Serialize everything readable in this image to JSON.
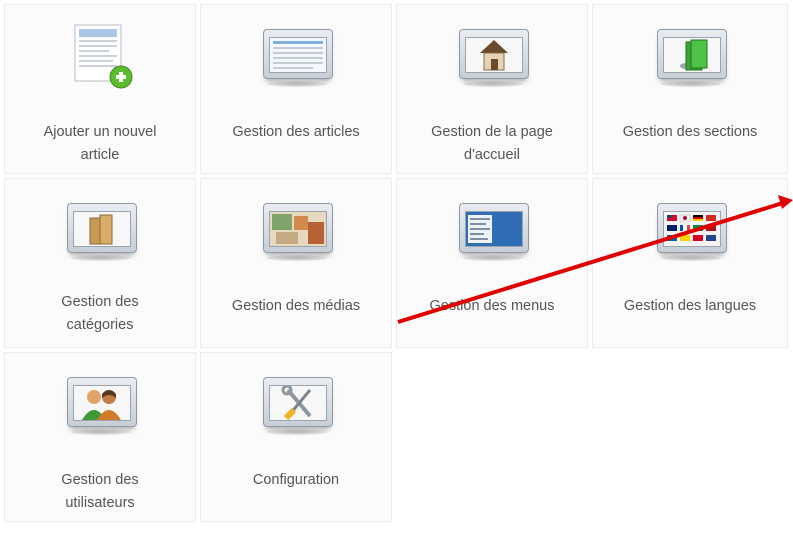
{
  "tiles": [
    {
      "label_lines": [
        "Ajouter un nouvel",
        "article"
      ],
      "icon": "add-article-icon"
    },
    {
      "label_lines": [
        "Gestion des articles"
      ],
      "icon": "articles-icon"
    },
    {
      "label_lines": [
        "Gestion de la page",
        "d'accueil"
      ],
      "icon": "home-page-icon"
    },
    {
      "label_lines": [
        "Gestion des sections"
      ],
      "icon": "sections-icon"
    },
    {
      "label_lines": [
        "Gestion des",
        "catégories"
      ],
      "icon": "categories-icon"
    },
    {
      "label_lines": [
        "Gestion des médias"
      ],
      "icon": "media-icon"
    },
    {
      "label_lines": [
        "Gestion des menus"
      ],
      "icon": "menus-icon"
    },
    {
      "label_lines": [
        "Gestion des langues"
      ],
      "icon": "languages-icon"
    },
    {
      "label_lines": [
        "Gestion des",
        "utilisateurs"
      ],
      "icon": "users-icon"
    },
    {
      "label_lines": [
        "Configuration"
      ],
      "icon": "configuration-icon"
    }
  ],
  "colors": {
    "annotation_arrow": "#e00000",
    "label_text": "#555555",
    "tile_border": "#ececec"
  }
}
